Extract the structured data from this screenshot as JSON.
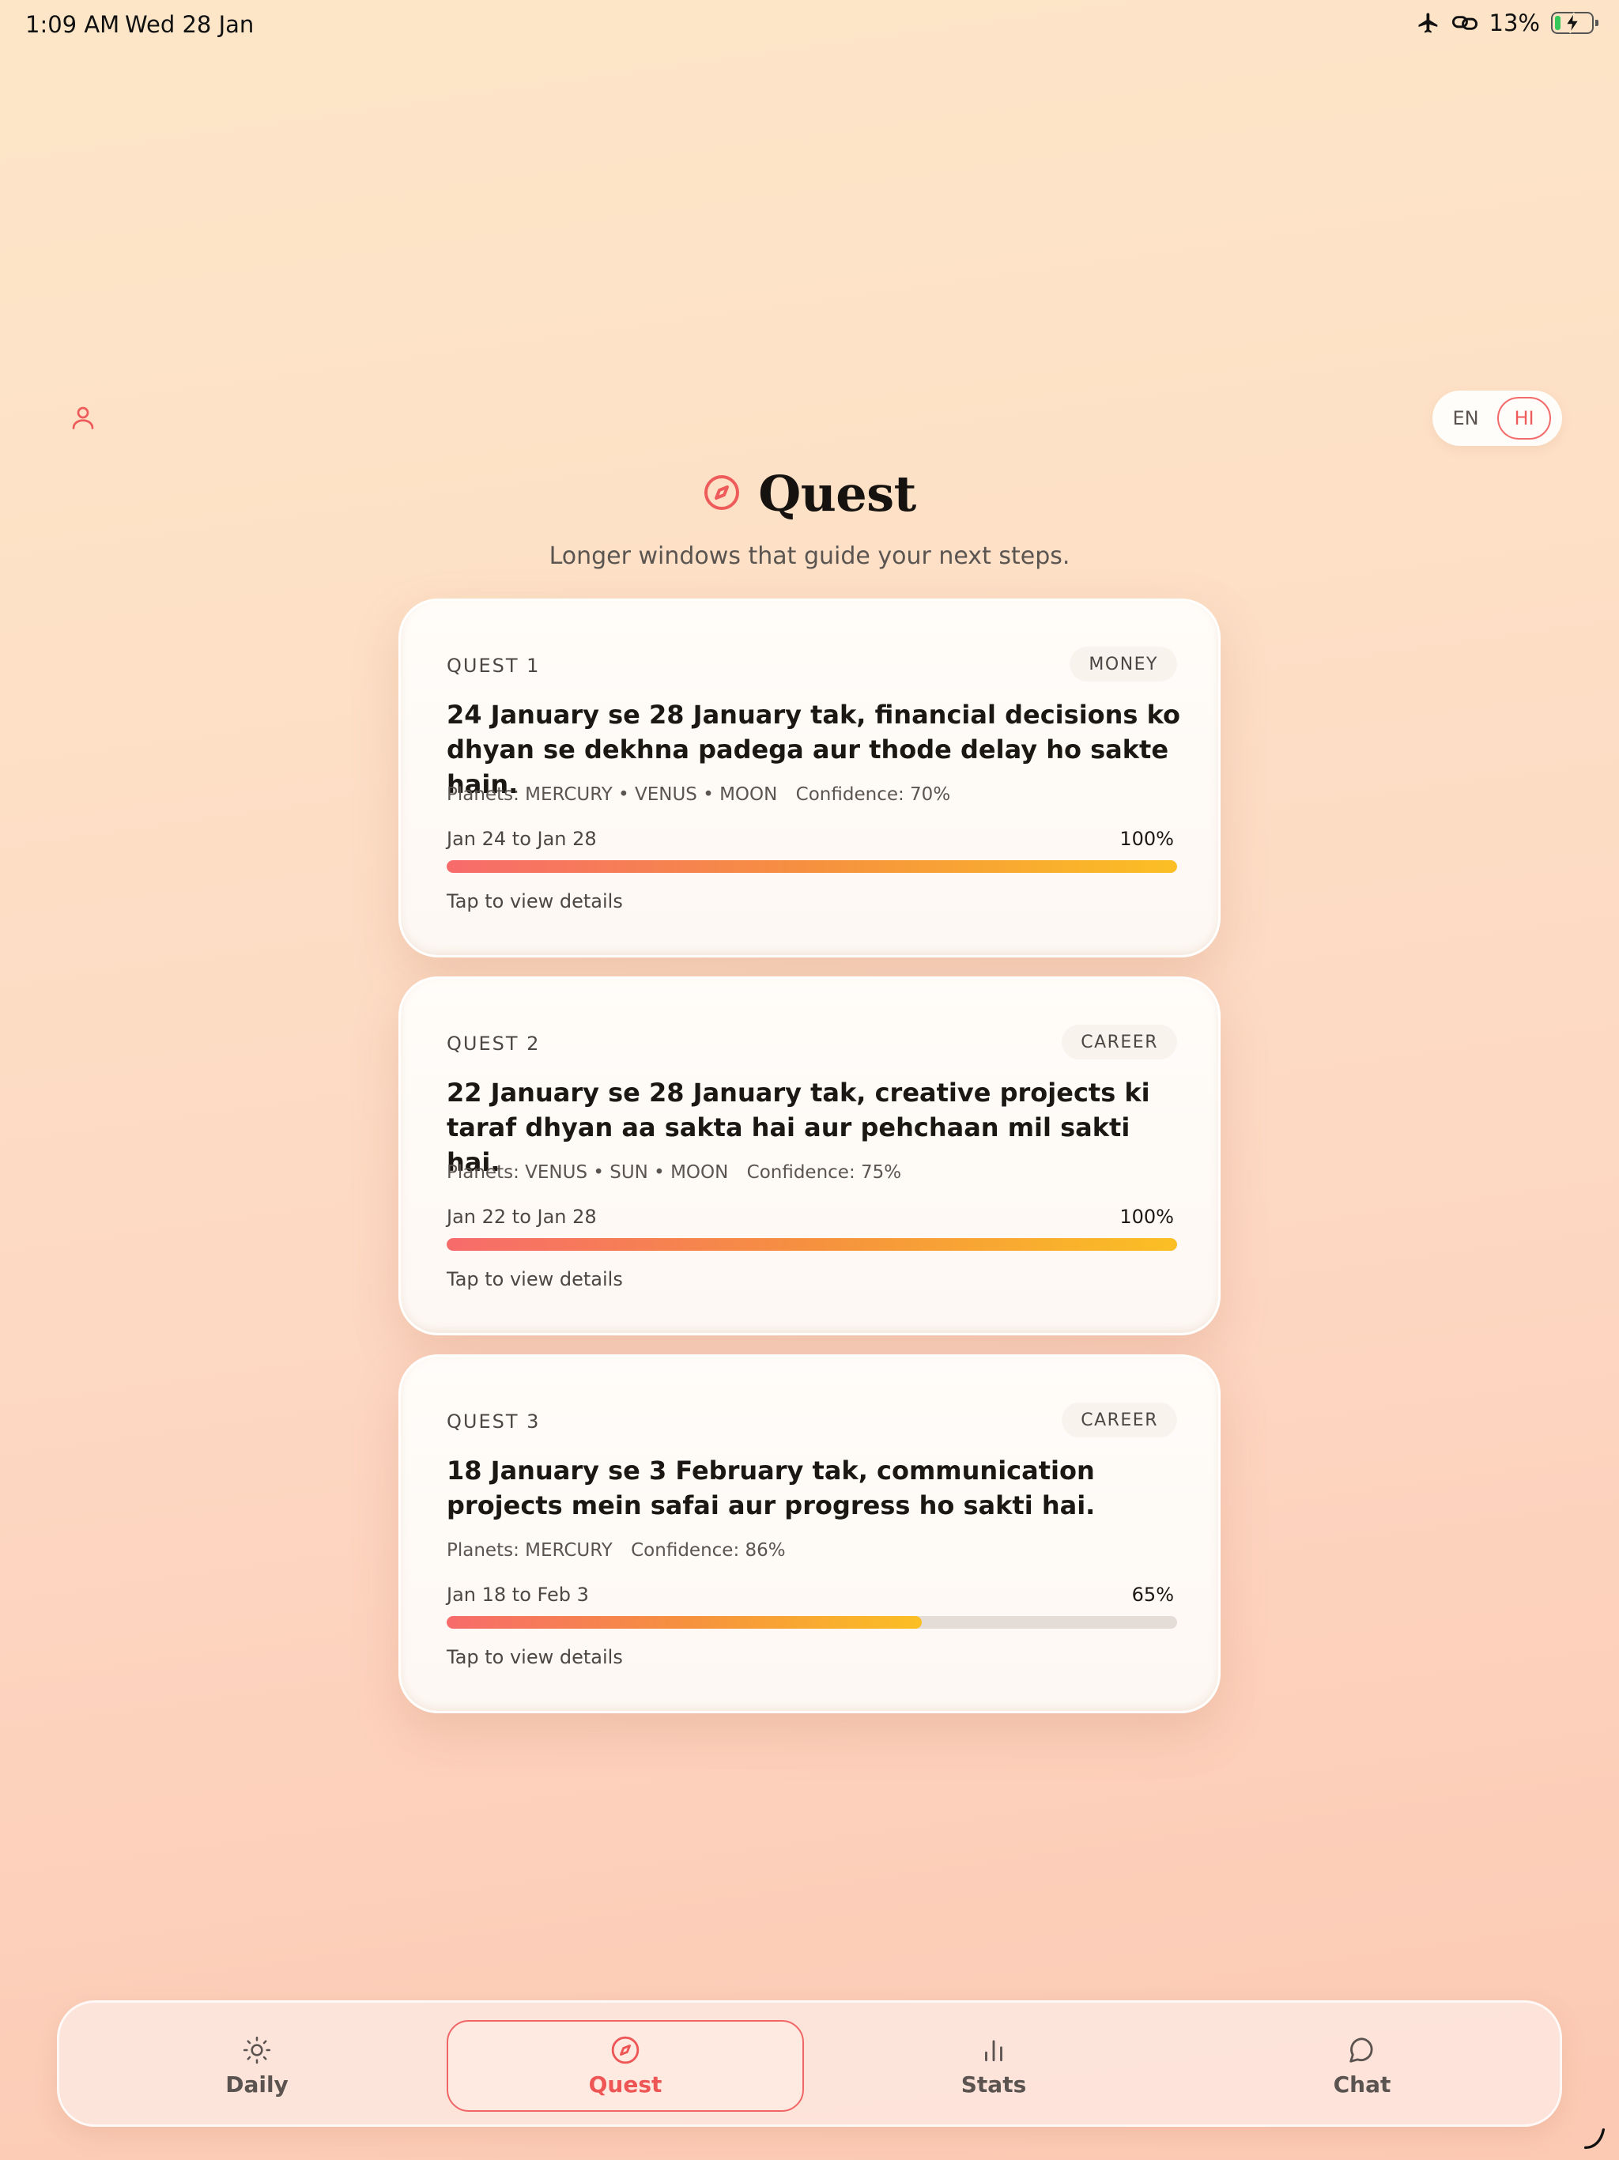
{
  "status_bar": {
    "time": "1:09 AM",
    "date": "Wed 28 Jan",
    "battery": "13%",
    "icons": [
      "airplane-icon",
      "link-icon",
      "battery-charging-icon"
    ]
  },
  "header": {
    "language_options": [
      "EN",
      "HI"
    ],
    "selected_language": "HI",
    "title": "Quest",
    "subtitle": "Longer windows that guide your next steps."
  },
  "quests": [
    {
      "label": "QUEST 1",
      "tag": "MONEY",
      "text": "24 January se 28 January tak, financial decisions ko dhyan se dekhna padega aur thode delay ho sakte hain.",
      "planets": "Planets: MERCURY • VENUS • MOON",
      "confidence": "Confidence: 70%",
      "range": "Jan 24 to Jan 28",
      "percent_label": "100%",
      "progress": 1.0,
      "cta": "Tap to view details"
    },
    {
      "label": "QUEST 2",
      "tag": "CAREER",
      "text": "22 January se 28 January tak, creative projects ki taraf dhyan aa sakta hai aur pehchaan mil sakti hai.",
      "planets": "Planets: VENUS • SUN • MOON",
      "confidence": "Confidence: 75%",
      "range": "Jan 22 to Jan 28",
      "percent_label": "100%",
      "progress": 1.0,
      "cta": "Tap to view details"
    },
    {
      "label": "QUEST 3",
      "tag": "CAREER",
      "text": "18 January se 3 February tak, communication projects mein safai aur progress ho sakti hai.",
      "planets": "Planets: MERCURY",
      "confidence": "Confidence: 86%",
      "range": "Jan 18 to Feb 3",
      "percent_label": "65%",
      "progress": 0.65,
      "cta": "Tap to view details"
    }
  ],
  "nav": {
    "items": [
      {
        "label": "Daily",
        "icon": "sun-icon"
      },
      {
        "label": "Quest",
        "icon": "compass-icon"
      },
      {
        "label": "Stats",
        "icon": "bar-chart-icon"
      },
      {
        "label": "Chat",
        "icon": "chat-bubble-icon"
      }
    ],
    "active": "Quest"
  },
  "colors": {
    "accent": "#f06666",
    "progress_start": "#f76b6b",
    "progress_end": "#fbbf24",
    "card_bg": "#fffcf9"
  }
}
